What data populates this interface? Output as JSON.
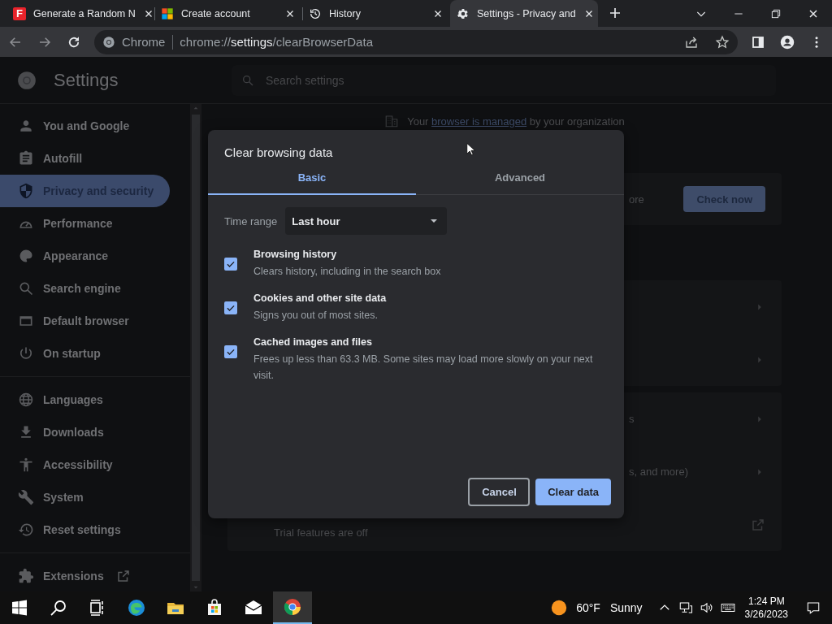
{
  "browser": {
    "tabs": [
      {
        "kind": "letter",
        "favicon_text": "F",
        "title": "Generate a Random N",
        "selected": false
      },
      {
        "kind": "squares",
        "title": "Create account",
        "selected": false
      },
      {
        "kind": "history",
        "title": "History",
        "selected": false
      },
      {
        "kind": "gear",
        "title": "Settings - Privacy and",
        "selected": true
      }
    ],
    "address": {
      "site_label": "Chrome",
      "url": "chrome://**settings**/clearBrowserData"
    }
  },
  "settings": {
    "title": "Settings",
    "search": {
      "placeholder": "Search settings"
    },
    "sidebar": {
      "sections": [
        {
          "items": [
            {
              "kind": "account",
              "label": "You and Google",
              "selected": false
            },
            {
              "kind": "autofill",
              "label": "Autofill",
              "selected": false
            },
            {
              "kind": "privacy",
              "label": "Privacy and security",
              "selected": true
            },
            {
              "kind": "performance",
              "label": "Performance",
              "selected": false
            },
            {
              "kind": "appearance",
              "label": "Appearance",
              "selected": false
            },
            {
              "kind": "search",
              "label": "Search engine",
              "selected": false
            },
            {
              "kind": "browser",
              "label": "Default browser",
              "selected": false
            },
            {
              "kind": "startup",
              "label": "On startup",
              "selected": false
            }
          ]
        },
        {
          "items": [
            {
              "kind": "languages",
              "label": "Languages",
              "selected": false
            },
            {
              "kind": "downloads",
              "label": "Downloads",
              "selected": false
            },
            {
              "kind": "accessibility",
              "label": "Accessibility",
              "selected": false
            },
            {
              "kind": "system",
              "label": "System",
              "selected": false
            },
            {
              "kind": "reset",
              "label": "Reset settings",
              "selected": false
            }
          ]
        },
        {
          "items": [
            {
              "kind": "extensions",
              "label": "Extensions",
              "selected": false,
              "external": true
            }
          ]
        }
      ]
    },
    "banner": {
      "before": "Your",
      "link": "browser is managed",
      "after": "by your organization"
    },
    "cards": [
      {
        "rows": [
          {
            "kind": "button",
            "text": "ore",
            "button": "Check now"
          }
        ]
      },
      {
        "rows": [
          {
            "kind": "arrow"
          },
          {
            "kind": "arrow"
          }
        ]
      },
      {
        "rows": [
          {
            "kind": "arrow",
            "text": "s"
          },
          {
            "kind": "arrow",
            "text": "s, and more)"
          },
          {
            "kind": "external",
            "lead": "Trial features are off"
          }
        ]
      }
    ]
  },
  "dialog": {
    "title": "Clear browsing data",
    "tabs": [
      {
        "label": "Basic",
        "selected": true
      },
      {
        "label": "Advanced",
        "selected": false
      }
    ],
    "time_range": {
      "label": "Time range",
      "value": "Last hour"
    },
    "options": [
      {
        "title": "Browsing history",
        "description": "Clears history, including in the search box",
        "checked": true
      },
      {
        "title": "Cookies and other site data",
        "description": "Signs you out of most sites.",
        "checked": true
      },
      {
        "title": "Cached images and files",
        "description": "Frees up less than 63.3 MB. Some sites may load more slowly on your next visit.",
        "checked": true
      }
    ],
    "buttons": [
      {
        "kind": "secondary",
        "label": "Cancel"
      },
      {
        "kind": "primary",
        "label": "Clear data"
      }
    ]
  },
  "taskbar": {
    "apps": [
      {
        "kind": "start",
        "active": false
      },
      {
        "kind": "search",
        "active": false
      },
      {
        "kind": "taskview",
        "active": false
      },
      {
        "kind": "edge",
        "active": false
      },
      {
        "kind": "files",
        "active": false
      },
      {
        "kind": "store",
        "active": false
      },
      {
        "kind": "mail",
        "active": false
      },
      {
        "kind": "chrome",
        "active": true
      }
    ],
    "weather": {
      "temperature": "60°F",
      "condition": "Sunny"
    },
    "clock": {
      "time": "1:24 PM",
      "date": "3/26/2023"
    }
  }
}
